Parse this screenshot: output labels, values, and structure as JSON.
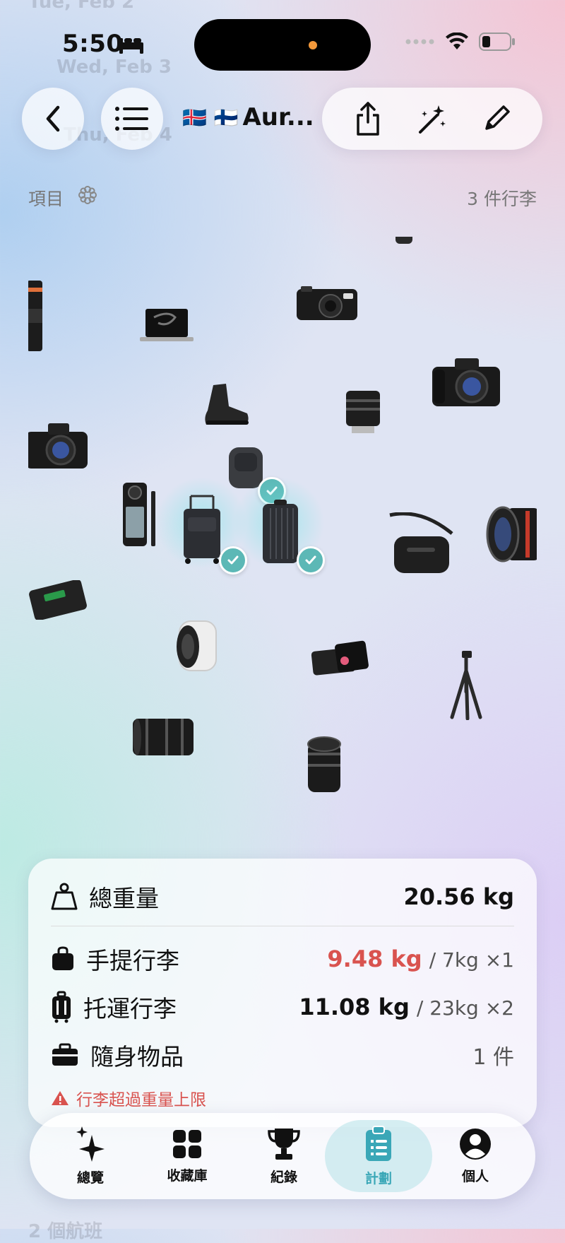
{
  "status": {
    "time": "5:50"
  },
  "behind": {
    "row1": "Tue, Feb 2",
    "row2": "Wed, Feb 3",
    "row3": "Thu, Feb 4",
    "bottom": "2 個航班"
  },
  "toolbar": {
    "flags": "🇮🇸 🇫🇮",
    "title": "Aur..."
  },
  "section": {
    "label": "項目",
    "count": "3 件行李"
  },
  "items": [
    {
      "name": "camera-lens"
    },
    {
      "name": "macbook"
    },
    {
      "name": "leica-camera"
    },
    {
      "name": "sony-camera"
    },
    {
      "name": "hiking-boot"
    },
    {
      "name": "leica-lens"
    },
    {
      "name": "sony-camera"
    },
    {
      "name": "backpack",
      "checked": true
    },
    {
      "name": "insta360-camera"
    },
    {
      "name": "carry-on-suitcase",
      "checked": true
    },
    {
      "name": "checked-suitcase",
      "checked": true
    },
    {
      "name": "sling-bag"
    },
    {
      "name": "wide-angle-lens"
    },
    {
      "name": "camera-battery"
    },
    {
      "name": "teleconverter"
    },
    {
      "name": "led-light"
    },
    {
      "name": "tripod"
    },
    {
      "name": "zoom-lens"
    },
    {
      "name": "manual-lens"
    }
  ],
  "summary": {
    "total_label": "總重量",
    "total_value": "20.56 kg",
    "carry_label": "手提行李",
    "carry_value": "9.48 kg",
    "carry_limit": "/ 7kg ×1",
    "checked_label": "托運行李",
    "checked_value": "11.08 kg",
    "checked_limit": "/ 23kg ×2",
    "personal_label": "隨身物品",
    "personal_value": "1 件",
    "warning": "行李超過重量上限"
  },
  "colors": {
    "accent": "#3aa7b7",
    "warning": "#d9534f",
    "check": "#5cb8b6"
  },
  "tabs": [
    {
      "label": "總覽",
      "icon": "sparkles-icon"
    },
    {
      "label": "收藏庫",
      "icon": "grid-icon"
    },
    {
      "label": "紀錄",
      "icon": "trophy-icon"
    },
    {
      "label": "計劃",
      "icon": "clipboard-icon",
      "active": true
    },
    {
      "label": "個人",
      "icon": "person-icon"
    }
  ]
}
